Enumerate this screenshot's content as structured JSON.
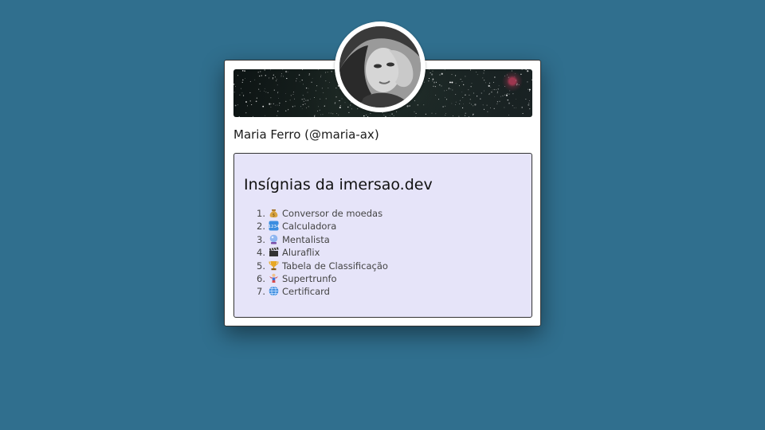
{
  "profile": {
    "name_handle": "Maria Ferro (@maria-ax)"
  },
  "badges": {
    "title": "Insígnias da imersao.dev",
    "items": [
      {
        "number": "1.",
        "icon": "money-bag-icon",
        "label": "Conversor de moedas"
      },
      {
        "number": "2.",
        "icon": "numbers-keypad-icon",
        "label": "Calculadora"
      },
      {
        "number": "3.",
        "icon": "crystal-ball-icon",
        "label": "Mentalista"
      },
      {
        "number": "4.",
        "icon": "clapperboard-icon",
        "label": "Aluraflix"
      },
      {
        "number": "5.",
        "icon": "trophy-icon",
        "label": "Tabela de Classificação"
      },
      {
        "number": "6.",
        "icon": "superhero-icon",
        "label": "Supertrunfo"
      },
      {
        "number": "7.",
        "icon": "globe-icon",
        "label": "Certificard"
      }
    ]
  },
  "colors": {
    "page_background": "#306f8e",
    "card_background": "#ffffff",
    "badges_background": "#e6e4f9"
  }
}
